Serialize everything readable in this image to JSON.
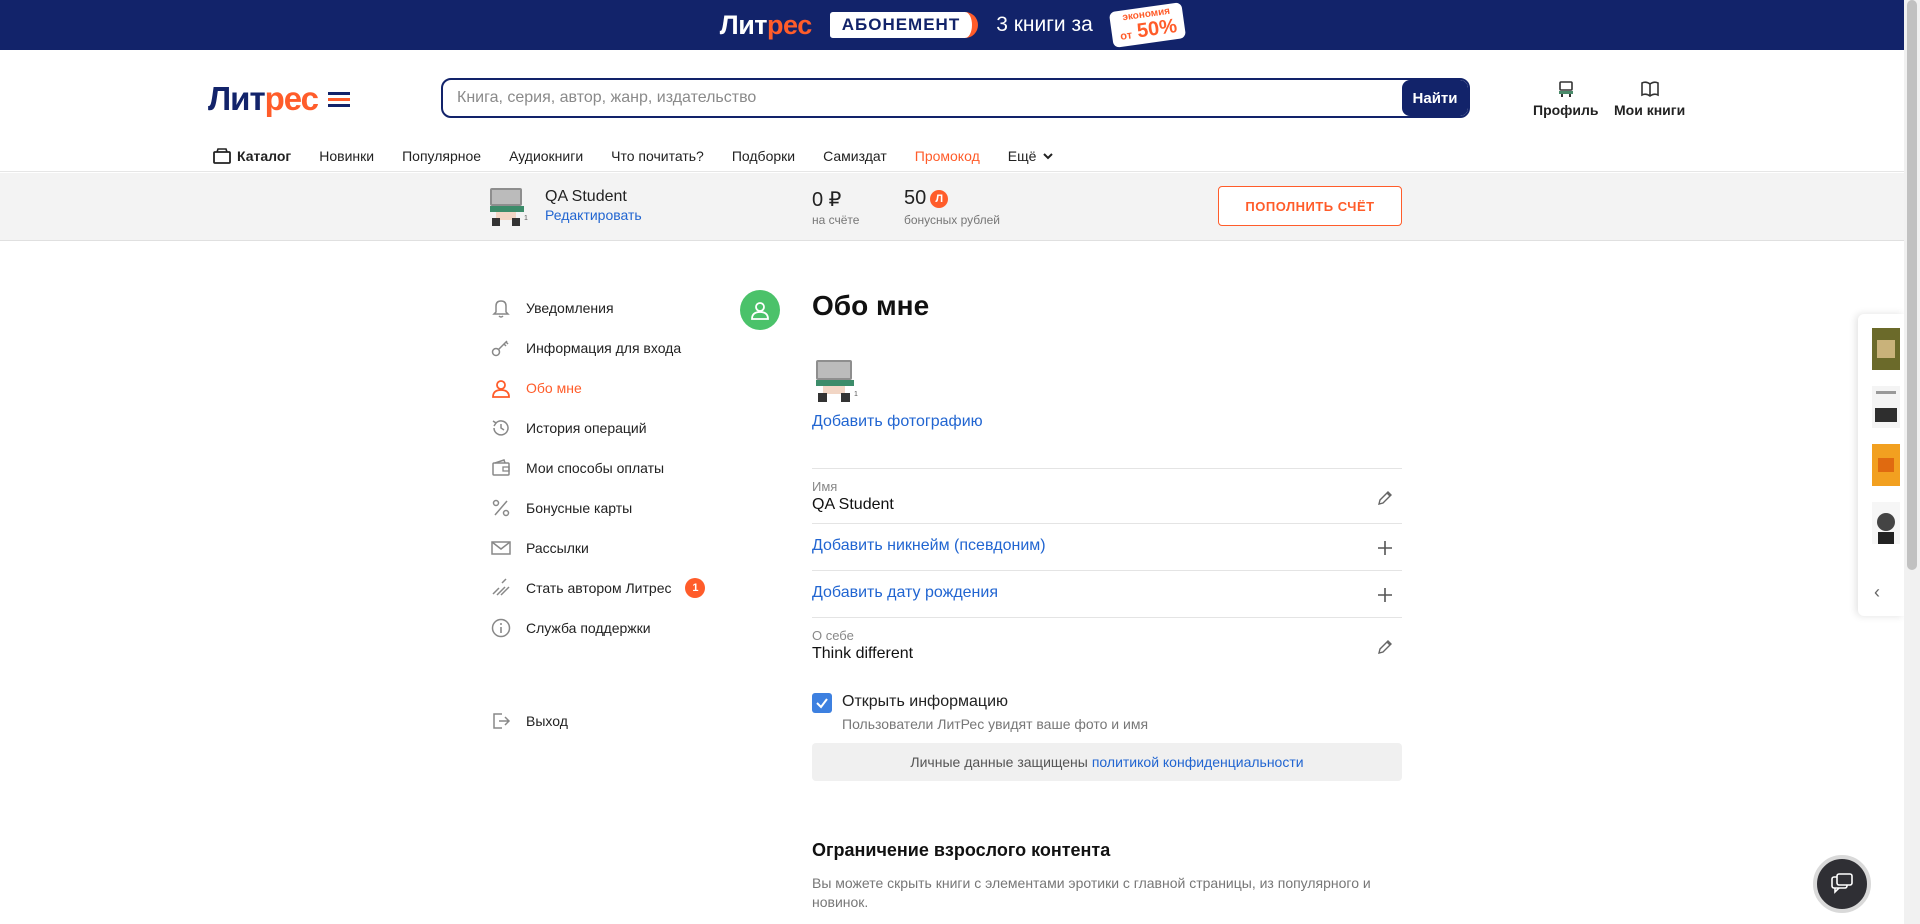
{
  "promo": {
    "logo_main": "Лит",
    "logo_accent": "рес",
    "pill": "АБОНЕМЕНТ",
    "text": "3 книги за",
    "sticker_top": "экономия",
    "sticker_prefix": "от",
    "sticker_value": "50%"
  },
  "header": {
    "logo_main": "Лит",
    "logo_accent": "рес",
    "search_placeholder": "Книга, серия, автор, жанр, издательство",
    "search_button": "Найти",
    "profile_label": "Профиль",
    "mybooks_label": "Мои книги"
  },
  "nav": {
    "catalog": "Каталог",
    "items": [
      "Новинки",
      "Популярное",
      "Аудиокниги",
      "Что почитать?",
      "Подборки",
      "Самиздат"
    ],
    "promocode": "Промокод",
    "more": "Ещё"
  },
  "account": {
    "name": "QA Student",
    "edit": "Редактировать",
    "balance": "0 ₽",
    "balance_label": "на счёте",
    "bonus": "50",
    "bonus_coin": "Л",
    "bonus_label": "бонусных рублей",
    "topup_button": "ПОПОЛНИТЬ СЧЁТ"
  },
  "side_menu": {
    "items": [
      {
        "label": "Уведомления",
        "icon": "bell-icon"
      },
      {
        "label": "Информация для входа",
        "icon": "key-icon"
      },
      {
        "label": "Обо мне",
        "icon": "user-icon"
      },
      {
        "label": "История операций",
        "icon": "history-icon"
      },
      {
        "label": "Мои способы оплаты",
        "icon": "wallet-icon"
      },
      {
        "label": "Бонусные карты",
        "icon": "percent-icon"
      },
      {
        "label": "Рассылки",
        "icon": "mail-icon"
      },
      {
        "label": "Стать автором Литрес",
        "icon": "pen-icon",
        "badge": "1"
      },
      {
        "label": "Служба поддержки",
        "icon": "info-icon"
      }
    ],
    "exit": "Выход"
  },
  "main": {
    "title": "Обо мне",
    "add_photo": "Добавить фотографию",
    "name_label": "Имя",
    "name_value": "QA Student",
    "add_nickname": "Добавить никнейм (псевдоним)",
    "add_birthdate": "Добавить дату рождения",
    "about_label": "О себе",
    "about_value": "Think different",
    "open_info_label": "Открыть информацию",
    "open_info_checked": true,
    "open_info_hint": "Пользователи ЛитРес увидят ваше фото и имя",
    "privacy_text": "Личные данные защищены",
    "privacy_link": "политикой конфиденциальности",
    "adult_title": "Ограничение взрослого контента",
    "adult_desc": "Вы можете скрыть книги с элементами эротики с главной страницы, из популярного и новинок."
  },
  "colors": {
    "brand_navy": "#12236a",
    "brand_orange": "#ff5c2a",
    "link_blue": "#2165d1",
    "success_green": "#4bc26a"
  }
}
